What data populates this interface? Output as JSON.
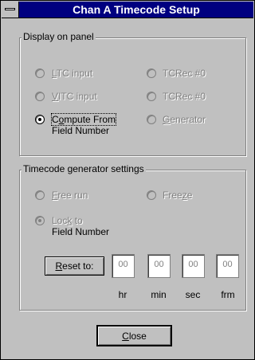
{
  "window": {
    "title": "Chan A Timecode Setup"
  },
  "display_group": {
    "label": "Display on panel",
    "options": [
      {
        "label": "LTC input",
        "mnemonic": "L",
        "selected": false,
        "enabled": false
      },
      {
        "label": "TCRec #0",
        "mnemonic": "",
        "selected": false,
        "enabled": false
      },
      {
        "label": "VITC input",
        "mnemonic": "V",
        "selected": false,
        "enabled": false
      },
      {
        "label": "TCRec #0",
        "mnemonic": "",
        "selected": false,
        "enabled": false
      },
      {
        "label_line1": "Compute From",
        "label_line2": "Field Number",
        "mnemonic": "o",
        "selected": true,
        "enabled": true
      },
      {
        "label": "Generator",
        "mnemonic": "G",
        "selected": false,
        "enabled": false
      }
    ]
  },
  "generator_group": {
    "label": "Timecode generator settings",
    "free_run": "Free run",
    "freeze": "Freeze",
    "lock_line1": "Lock to",
    "lock_line2": "Field Number",
    "reset_button": "Reset to:",
    "fields": [
      {
        "value": "00",
        "unit": "hr"
      },
      {
        "value": "00",
        "unit": "min"
      },
      {
        "value": "00",
        "unit": "sec"
      },
      {
        "value": "00",
        "unit": "frm"
      }
    ]
  },
  "close_button": "Close"
}
